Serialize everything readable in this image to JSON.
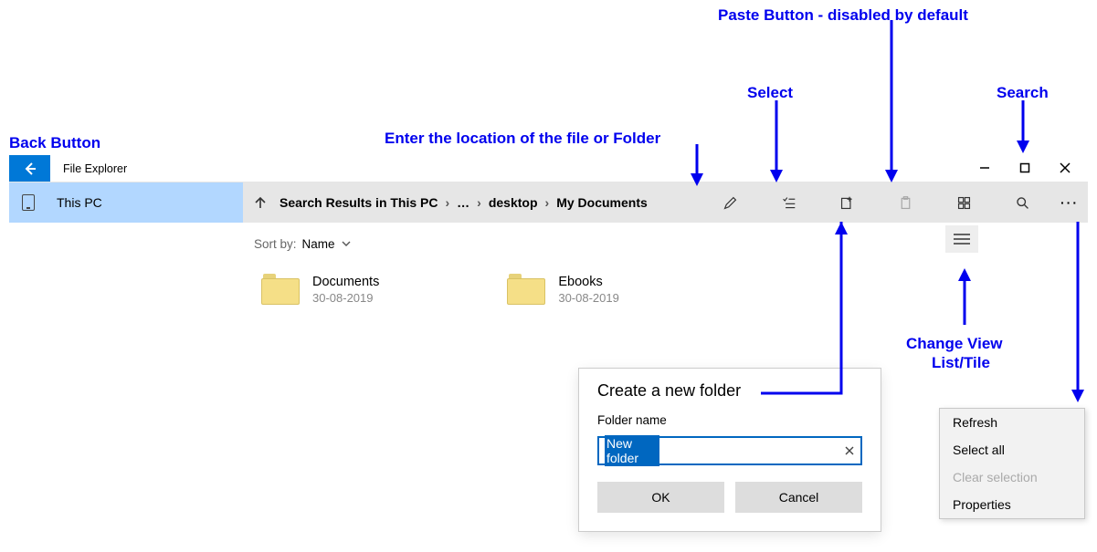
{
  "annotations": {
    "back": "Back Button",
    "paste": "Paste Button - disabled by default",
    "select": "Select",
    "search": "Search",
    "enter_location": "Enter the location of the file or Folder",
    "change_view": "Change View",
    "list_tile": "List/Tile"
  },
  "titlebar": {
    "title": "File Explorer"
  },
  "nav": {
    "selected": "This PC"
  },
  "breadcrumb": {
    "root": "Search Results in This PC",
    "parts": [
      "…",
      "desktop",
      "My Documents"
    ]
  },
  "sort": {
    "label": "Sort by:",
    "value": "Name"
  },
  "folders": [
    {
      "name": "Documents",
      "date": "30-08-2019"
    },
    {
      "name": "Ebooks",
      "date": "30-08-2019"
    }
  ],
  "dialog": {
    "title": "Create a new folder",
    "field_label": "Folder name",
    "value": "New folder",
    "ok": "OK",
    "cancel": "Cancel"
  },
  "context_menu": {
    "refresh": "Refresh",
    "select_all": "Select all",
    "clear_selection": "Clear selection",
    "properties": "Properties"
  }
}
